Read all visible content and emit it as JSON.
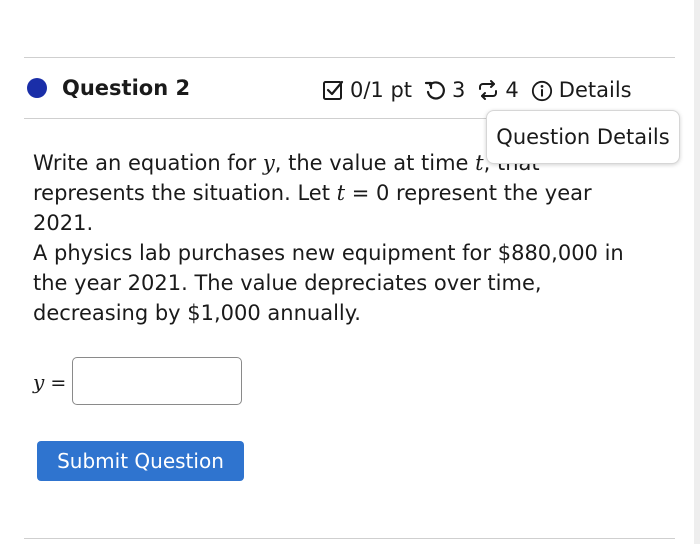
{
  "question": {
    "title": "Question 2",
    "points": "0/1 pt",
    "retries": "3",
    "attempts": "4",
    "details_label": "Details"
  },
  "tooltip": {
    "text": "Question Details"
  },
  "prompt": {
    "p1_a": "Write an equation for ",
    "p1_var_y": "y",
    "p1_b": ", the value at time ",
    "p1_var_t": "t",
    "p1_c": ", that represents the situation. Let ",
    "p1_var_t2": "t",
    "p1_d": " = 0 represent the year 2021.",
    "p2": "A physics lab purchases new equipment for $880,000 in the year 2021. The value depreciates over time, decreasing by $1,000 annually."
  },
  "answer": {
    "var": "y",
    "equals": " =",
    "value": ""
  },
  "submit_label": "Submit Question",
  "colors": {
    "dot": "#1a2ea8",
    "submit_bg": "#2f74cf"
  },
  "icons": [
    "check-square-icon",
    "retry-icon",
    "attempts-icon",
    "info-icon"
  ]
}
